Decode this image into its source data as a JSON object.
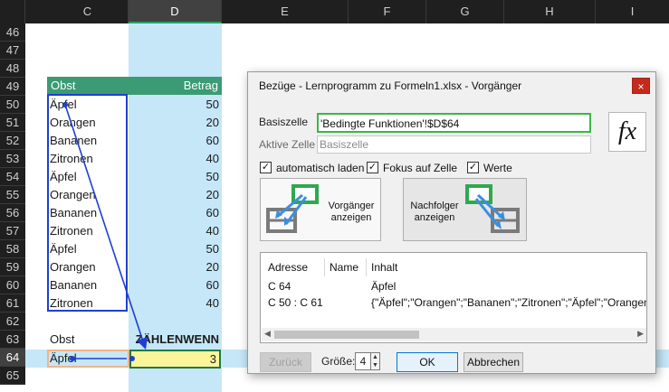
{
  "sheet": {
    "columns": [
      "C",
      "D",
      "E",
      "F",
      "G",
      "H",
      "I"
    ],
    "selected_column": "D",
    "rows": [
      "46",
      "47",
      "48",
      "49",
      "50",
      "51",
      "52",
      "53",
      "54",
      "55",
      "56",
      "57",
      "58",
      "59",
      "60",
      "61",
      "62",
      "63",
      "64",
      "65"
    ],
    "selected_row": "64",
    "table": {
      "header_obst": "Obst",
      "header_betrag": "Betrag",
      "obst": [
        "Äpfel",
        "Orangen",
        "Bananen",
        "Zitronen",
        "Äpfel",
        "Orangen",
        "Bananen",
        "Zitronen",
        "Äpfel",
        "Orangen",
        "Bananen",
        "Zitronen"
      ],
      "betrag": [
        "50",
        "20",
        "60",
        "40",
        "50",
        "20",
        "60",
        "40",
        "50",
        "20",
        "60",
        "40"
      ]
    },
    "criteria_label": "Obst",
    "formula_label": "ZÄHLENWENN",
    "criteria_value": "Äpfel",
    "formula_result": "3",
    "colors": {
      "header_bg": "#1f1f1f",
      "table_header": "#3b9b75",
      "selection_band": "#c5e7f7",
      "precedent_box": "#1f3fd1",
      "active_cell": "#fbf59a"
    }
  },
  "dialog": {
    "title": "Bezüge - Lernprogramm zu Formeln1.xlsx - Vorgänger",
    "close_label": "×",
    "basiszelle_label": "Basiszelle",
    "basiszelle_value": "'Bedingte Funktionen'!$D$64",
    "aktive_zelle_label": "Aktive Zelle",
    "aktive_zelle_placeholder": "Basiszelle",
    "fx_label": "fx",
    "checkboxes": {
      "auto": {
        "label": "automatisch laden",
        "checked": true
      },
      "fokus": {
        "label": "Fokus auf Zelle",
        "checked": true
      },
      "werte": {
        "label": "Werte",
        "checked": true
      }
    },
    "vorgaenger_button": {
      "line1": "Vorgänger",
      "line2": "anzeigen"
    },
    "nachfolger_button": {
      "line1": "Nachfolger",
      "line2": "anzeigen"
    },
    "list": {
      "headers": {
        "adresse": "Adresse",
        "name": "Name",
        "inhalt": "Inhalt"
      },
      "rows": [
        {
          "adresse": "C 64",
          "name": "",
          "inhalt": "Äpfel"
        },
        {
          "adresse": "C 50 : C 61",
          "name": "",
          "inhalt": "{\"Äpfel\";\"Orangen\";\"Bananen\";\"Zitronen\";\"Äpfel\";\"Orangen\""
        }
      ]
    },
    "back_label": "Zurück",
    "size_label": "Größe:",
    "size_value": "4",
    "ok_label": "OK",
    "cancel_label": "Abbrechen"
  }
}
